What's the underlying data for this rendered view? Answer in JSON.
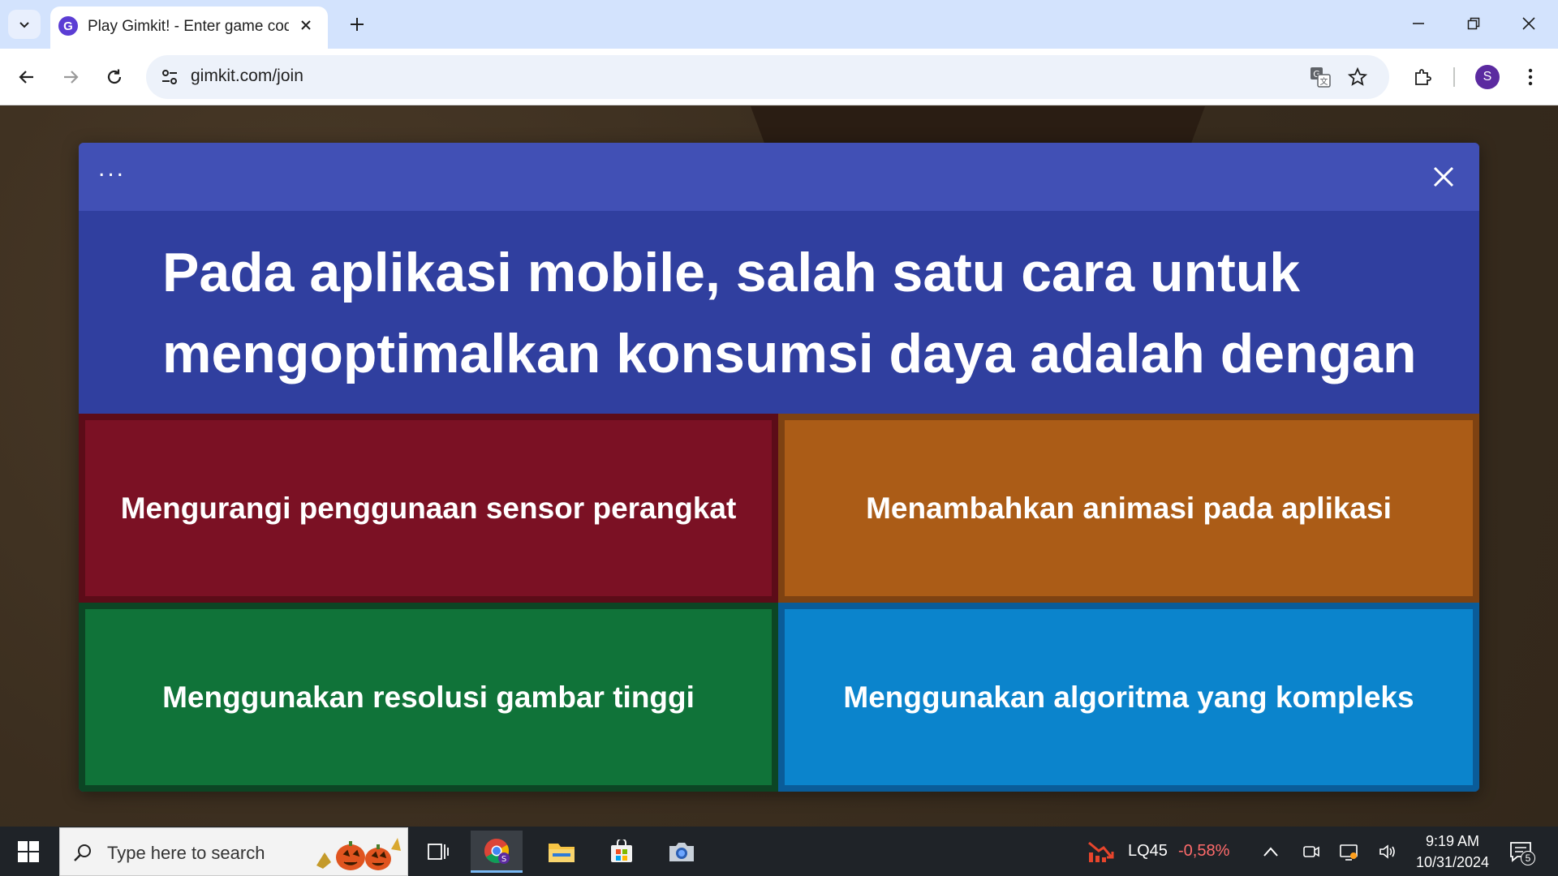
{
  "browser": {
    "tab": {
      "title": "Play Gimkit! - Enter game code",
      "favicon_letter": "G"
    },
    "url": "gimkit.com/join",
    "profile_initial": "S",
    "icons": {
      "tab_search": "chevron-down-icon",
      "tab_close": "close-icon",
      "new_tab": "plus-icon",
      "minimize": "minimize-icon",
      "restore": "restore-icon",
      "close": "close-icon",
      "back": "arrow-left-icon",
      "forward": "arrow-right-icon",
      "reload": "reload-icon",
      "site_info": "tune-icon",
      "translate": "translate-icon",
      "bookmark": "star-icon",
      "extensions": "puzzle-icon",
      "menu": "more-vert-icon"
    }
  },
  "quiz": {
    "header_menu": "...",
    "question": "Pada aplikasi mobile, salah satu cara untuk mengoptimalkan konsumsi daya adalah dengan ...",
    "answers": [
      {
        "text": "Mengurangi penggunaan sensor perangkat",
        "color": "#7b1124"
      },
      {
        "text": "Menambahkan animasi pada aplikasi",
        "color": "#ab5c17"
      },
      {
        "text": "Menggunakan resolusi gambar tinggi",
        "color": "#107339"
      },
      {
        "text": "Menggunakan algoritma yang kompleks",
        "color": "#0b84cc"
      }
    ],
    "colors": {
      "header": "#4150b5",
      "body": "#303f9f"
    }
  },
  "taskbar": {
    "search_placeholder": "Type here to search",
    "apps": [
      "task-view",
      "chrome",
      "file-explorer",
      "microsoft-store",
      "camera"
    ],
    "stock": {
      "name": "LQ45",
      "change": "-0,58%"
    },
    "time": "9:19 AM",
    "date": "10/31/2024",
    "notification_count": "5"
  }
}
